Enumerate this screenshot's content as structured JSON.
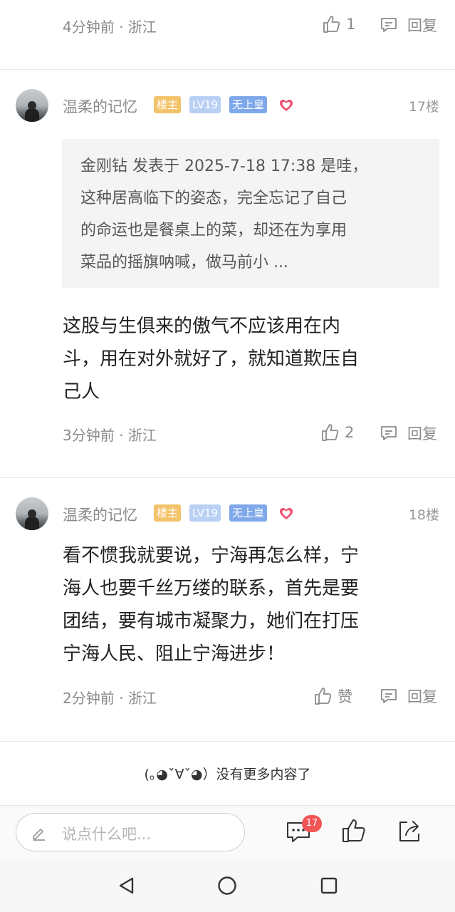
{
  "prev_comment": {
    "time_location": "4分钟前 · 浙江",
    "like_label": "1",
    "reply_label": "回复"
  },
  "comments": [
    {
      "username": "温柔的记忆",
      "badge_owner": "楼主",
      "badge_level": "LV19",
      "badge_rank": "无上皇",
      "floor": "17楼",
      "quote_lines": [
        "金刚钻 发表于 2025-7-18 17:38 是哇，",
        "这种居高临下的姿态，完全忘记了自己",
        "的命运也是餐桌上的菜，却还在为享用",
        "菜品的摇旗呐喊，做马前小 ..."
      ],
      "text_lines": [
        "这股与生俱来的傲气不应该用在内",
        "斗，用在对外就好了，就知道欺压自",
        "己人"
      ],
      "time_location": "3分钟前 · 浙江",
      "like_label": "2",
      "reply_label": "回复"
    },
    {
      "username": "温柔的记忆",
      "badge_owner": "楼主",
      "badge_level": "LV19",
      "badge_rank": "无上皇",
      "floor": "18楼",
      "text_lines": [
        "看不惯我就要说，宁海再怎么样，宁",
        "海人也要千丝万缕的联系，首先是要",
        "团结，要有城市凝聚力，她们在打压",
        "宁海人民、阻止宁海进步！"
      ],
      "time_location": "2分钟前 · 浙江",
      "like_label": "赞",
      "reply_label": "回复"
    }
  ],
  "no_more": "(｡◕ˇ∀ˇ◕）没有更多内容了",
  "bottom_bar": {
    "input_placeholder": "说点什么吧...",
    "comment_count": "17",
    "icons": [
      "pencil-icon",
      "comment-icon",
      "thumb-up-icon",
      "share-icon"
    ]
  },
  "nav_icons": [
    "back-triangle-icon",
    "home-circle-icon",
    "recents-square-icon"
  ],
  "colors": {
    "badge_owner": "#f3c36a",
    "badge_level": "#b9d0f5",
    "badge_rank": "#7ea8ea",
    "count_badge": "#f25555",
    "heart": "#f0506e"
  }
}
